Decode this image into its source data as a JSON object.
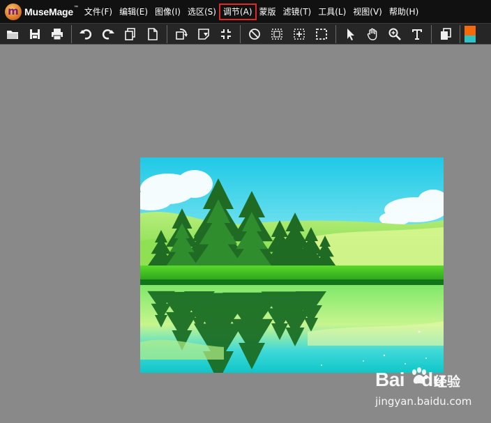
{
  "app": {
    "logo_letter": "m",
    "name": "MuseMage",
    "trademark": "™"
  },
  "menu": [
    {
      "label": "文件(F)",
      "name": "menu-file",
      "highlighted": false
    },
    {
      "label": "编辑(E)",
      "name": "menu-edit",
      "highlighted": false
    },
    {
      "label": "图像(I)",
      "name": "menu-image",
      "highlighted": false
    },
    {
      "label": "选区(S)",
      "name": "menu-select",
      "highlighted": false
    },
    {
      "label": "调节(A)",
      "name": "menu-adjust",
      "highlighted": true
    },
    {
      "label": "蒙版",
      "name": "menu-mask",
      "highlighted": false
    },
    {
      "label": "滤镜(T)",
      "name": "menu-filter",
      "highlighted": false
    },
    {
      "label": "工具(L)",
      "name": "menu-tools",
      "highlighted": false
    },
    {
      "label": "视图(V)",
      "name": "menu-view",
      "highlighted": false
    },
    {
      "label": "帮助(H)",
      "name": "menu-help",
      "highlighted": false
    }
  ],
  "toolbar": {
    "groups": [
      [
        "open-folder-icon",
        "save-icon",
        "print-icon"
      ],
      [
        "undo-icon",
        "redo-icon",
        "copy-icon",
        "new-document-icon"
      ],
      [
        "rotate-icon",
        "flip-icon",
        "crop-shrink-icon"
      ],
      [
        "deselect-icon",
        "select-rect-icon",
        "select-center-icon",
        "select-dashed-icon"
      ],
      [
        "pointer-icon",
        "hand-icon",
        "zoom-icon",
        "text-icon"
      ],
      [
        "layers-icon"
      ]
    ]
  },
  "colors": {
    "menubar_bg": "#111111",
    "toolbar_bg": "#262626",
    "canvas_bg": "#898989",
    "highlight_border": "#e02a2a",
    "swatch_foreground": "#f26a0a",
    "swatch_background": "#2ec4c4"
  },
  "watermark": {
    "brand": "Bai",
    "brand_suffix": "du",
    "cn": "经验",
    "url": "jingyan.baidu.com"
  }
}
